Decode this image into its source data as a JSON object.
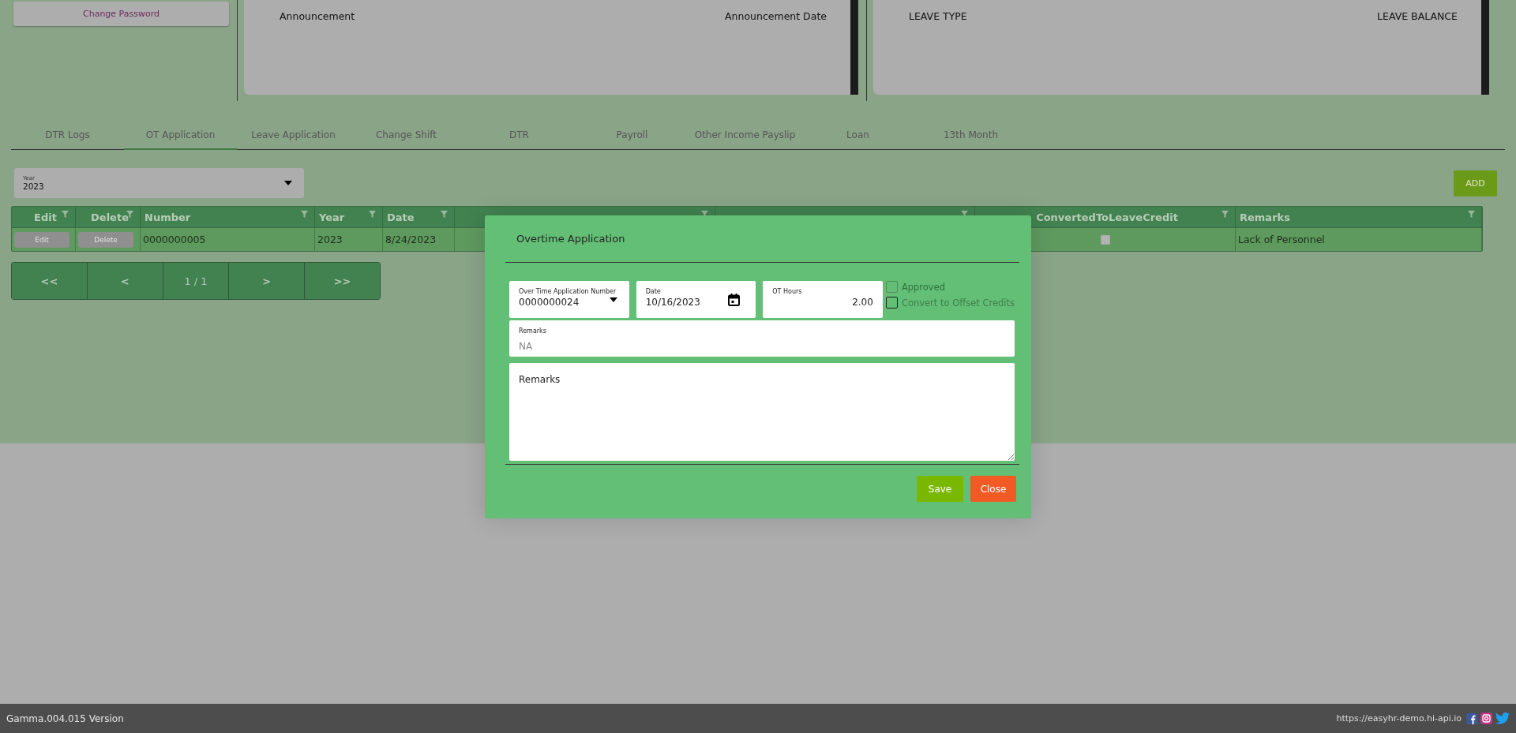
{
  "account": {
    "change_password": "Change Password"
  },
  "announcements": {
    "columns": [
      "Announcement",
      "Announcement Date"
    ]
  },
  "leave": {
    "columns": [
      "LEAVE TYPE",
      "LEAVE BALANCE"
    ]
  },
  "tabs": [
    {
      "label": "DTR Logs",
      "selected": false
    },
    {
      "label": "OT Application",
      "selected": true
    },
    {
      "label": "Leave Application",
      "selected": false
    },
    {
      "label": "Change Shift",
      "selected": false
    },
    {
      "label": "DTR",
      "selected": false
    },
    {
      "label": "Payroll",
      "selected": false
    },
    {
      "label": "Other Income Payslip",
      "selected": false
    },
    {
      "label": "Loan",
      "selected": false
    },
    {
      "label": "13th Month",
      "selected": false
    }
  ],
  "year_select": {
    "label": "Year",
    "value": "2023"
  },
  "add_button": "ADD",
  "table": {
    "columns": [
      {
        "label": "Edit"
      },
      {
        "label": "Delete"
      },
      {
        "label": "Number"
      },
      {
        "label": "Year"
      },
      {
        "label": "Date"
      },
      {},
      {},
      {
        "label": "ConvertedToLeaveCredit"
      },
      {
        "label": "Remarks"
      }
    ],
    "rows": [
      {
        "edit": "Edit",
        "delete": "Delete",
        "number": "0000000005",
        "year": "2023",
        "date": "8/24/2023",
        "converted": false,
        "remarks": "Lack of Personnel"
      }
    ]
  },
  "pager": {
    "first": "<<",
    "prev": "<",
    "page": "1 / 1",
    "next": ">",
    "last": ">>"
  },
  "dialog": {
    "title": "Overtime Application",
    "number": {
      "label": "Over Time Application Number",
      "value": "0000000024"
    },
    "date": {
      "label": "Date",
      "value": "10/16/2023"
    },
    "hours": {
      "label": "OT Hours",
      "value": "2.00"
    },
    "checks": [
      {
        "label": "Approved",
        "checked": false,
        "disabled": true
      },
      {
        "label": "Convert to Offset Credits",
        "checked": false,
        "disabled": false
      }
    ],
    "remarks_field": {
      "label": "Remarks",
      "placeholder": "NA"
    },
    "remarks_area": {
      "placeholder": "Remarks"
    },
    "save": "Save",
    "close": "Close"
  },
  "footer": {
    "version": "Gamma.004.015 Version",
    "url": "https://easyhr-demo.hi-api.io"
  }
}
